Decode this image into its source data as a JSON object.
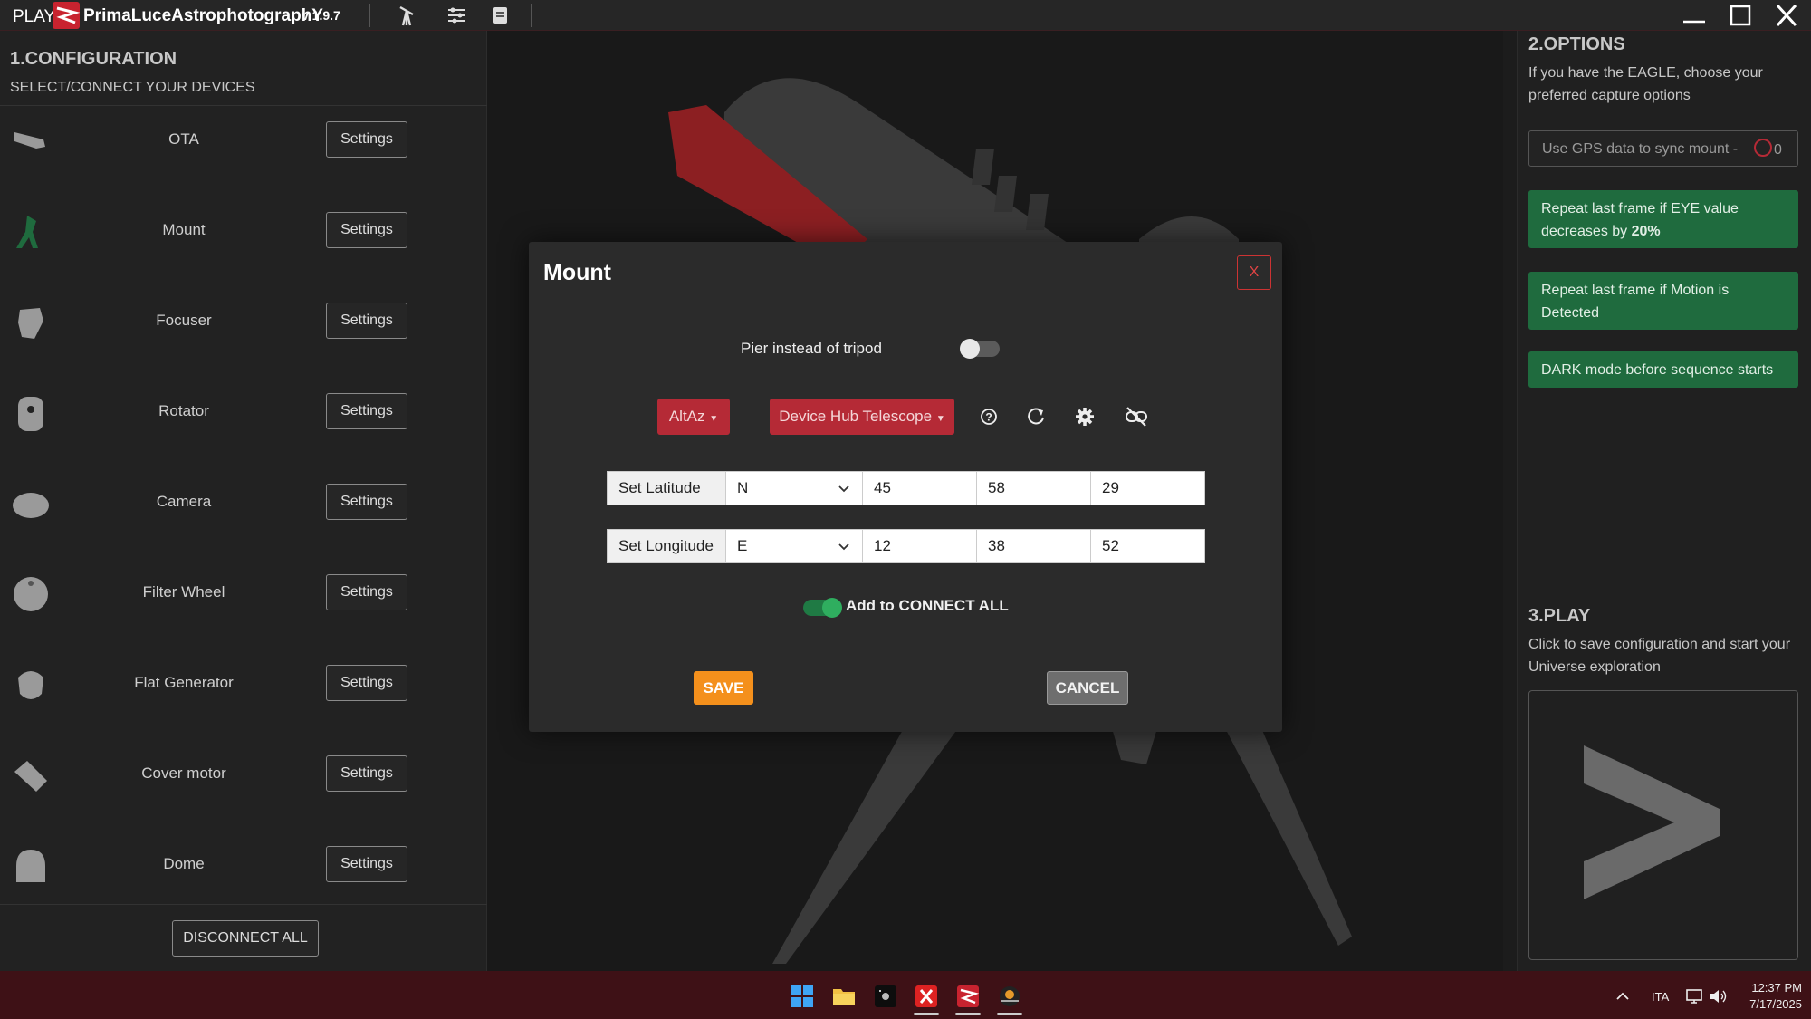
{
  "titlebar": {
    "play": "PLAY",
    "brand": "PrimaLuceAstrophotographY",
    "version": "v 1.9.7"
  },
  "config": {
    "title": "1.CONFIGURATION",
    "subtitle": "SELECT/CONNECT YOUR DEVICES",
    "settings_label": "Settings",
    "devices": [
      {
        "label": "OTA",
        "icon": "ota-icon"
      },
      {
        "label": "Mount",
        "icon": "mount-icon"
      },
      {
        "label": "Focuser",
        "icon": "focuser-icon"
      },
      {
        "label": "Rotator",
        "icon": "rotator-icon"
      },
      {
        "label": "Camera",
        "icon": "camera-icon"
      },
      {
        "label": "Filter Wheel",
        "icon": "filter-wheel-icon"
      },
      {
        "label": "Flat Generator",
        "icon": "flat-generator-icon"
      },
      {
        "label": "Cover motor",
        "icon": "cover-motor-icon"
      },
      {
        "label": "Dome",
        "icon": "dome-icon"
      }
    ],
    "disconnect_all": "DISCONNECT ALL"
  },
  "options": {
    "title": "2.OPTIONS",
    "subtitle": "If you have the EAGLE, choose your preferred capture options",
    "gps_label": "Use GPS data to sync mount -",
    "gps_value": "0",
    "repeat_eye_prefix": "Repeat last frame if EYE value decreases by",
    "repeat_eye_value": "20%",
    "repeat_motion": "Repeat last frame if Motion is Detected",
    "dark_mode": "DARK mode before sequence starts"
  },
  "play": {
    "title": "3.PLAY",
    "subtitle": "Click to save configuration and start your Universe exploration"
  },
  "dialog": {
    "title": "Mount",
    "close": "X",
    "pier_label": "Pier instead of tripod",
    "pier_on": false,
    "mode": "AltAz",
    "driver": "Device Hub Telescope",
    "latitude": {
      "label": "Set Latitude",
      "hemisphere": "N",
      "deg": "45",
      "min": "58",
      "sec": "29"
    },
    "longitude": {
      "label": "Set Longitude",
      "hemisphere": "E",
      "deg": "12",
      "min": "38",
      "sec": "52"
    },
    "connect_all_label": "Add to CONNECT ALL",
    "connect_all_on": true,
    "save": "SAVE",
    "cancel": "CANCEL"
  },
  "taskbar": {
    "lang": "ITA",
    "time": "12:37 PM",
    "date": "7/17/2025"
  },
  "colors": {
    "accent_red": "#b52a36",
    "save_orange": "#f4901c",
    "option_green": "#1f6b3e",
    "taskbar": "#3e1116"
  }
}
